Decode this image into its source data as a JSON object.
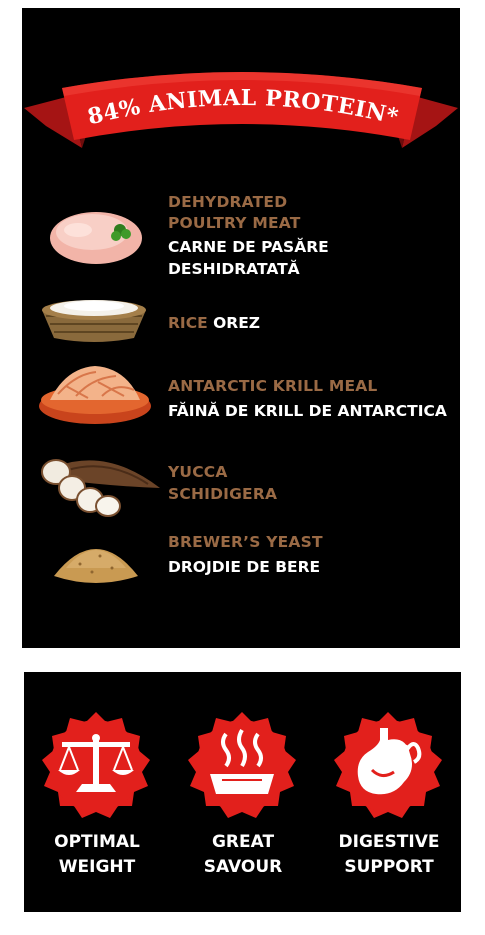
{
  "banner": {
    "text": "84% ANIMAL PROTEIN*"
  },
  "ingredients": [
    {
      "en_line1": "DEHYDRATED",
      "en_line2": "POULTRY MEAT",
      "ro_line1": "CARNE DE PASĂRE",
      "ro_line2": "DESHIDRATATĂ",
      "icon": "poultry-meat-icon"
    },
    {
      "en": "RICE",
      "ro": "OREZ",
      "icon": "rice-basket-icon"
    },
    {
      "en": "ANTARCTIC KRILL MEAL",
      "ro": "FĂINĂ DE KRILL DE ANTARCTICA",
      "icon": "krill-bowl-icon"
    },
    {
      "en_line1": "YUCCA",
      "en_line2": "SCHIDIGERA",
      "icon": "yucca-root-icon"
    },
    {
      "en": "BREWER’S YEAST",
      "ro": "DROJDIE DE BERE",
      "icon": "yeast-powder-icon"
    }
  ],
  "benefits": [
    {
      "line1": "OPTIMAL",
      "line2": "WEIGHT",
      "icon": "scale-icon"
    },
    {
      "line1": "GREAT",
      "line2": "SAVOUR",
      "icon": "bowl-aroma-icon"
    },
    {
      "line1": "DIGESTIVE",
      "line2": "SUPPORT",
      "icon": "stomach-icon"
    }
  ],
  "colors": {
    "background": "#000000",
    "accent_red": "#e2201c",
    "ribbon_dark": "#a01414",
    "brown_text": "#9a6a45",
    "white_text": "#ffffff"
  }
}
